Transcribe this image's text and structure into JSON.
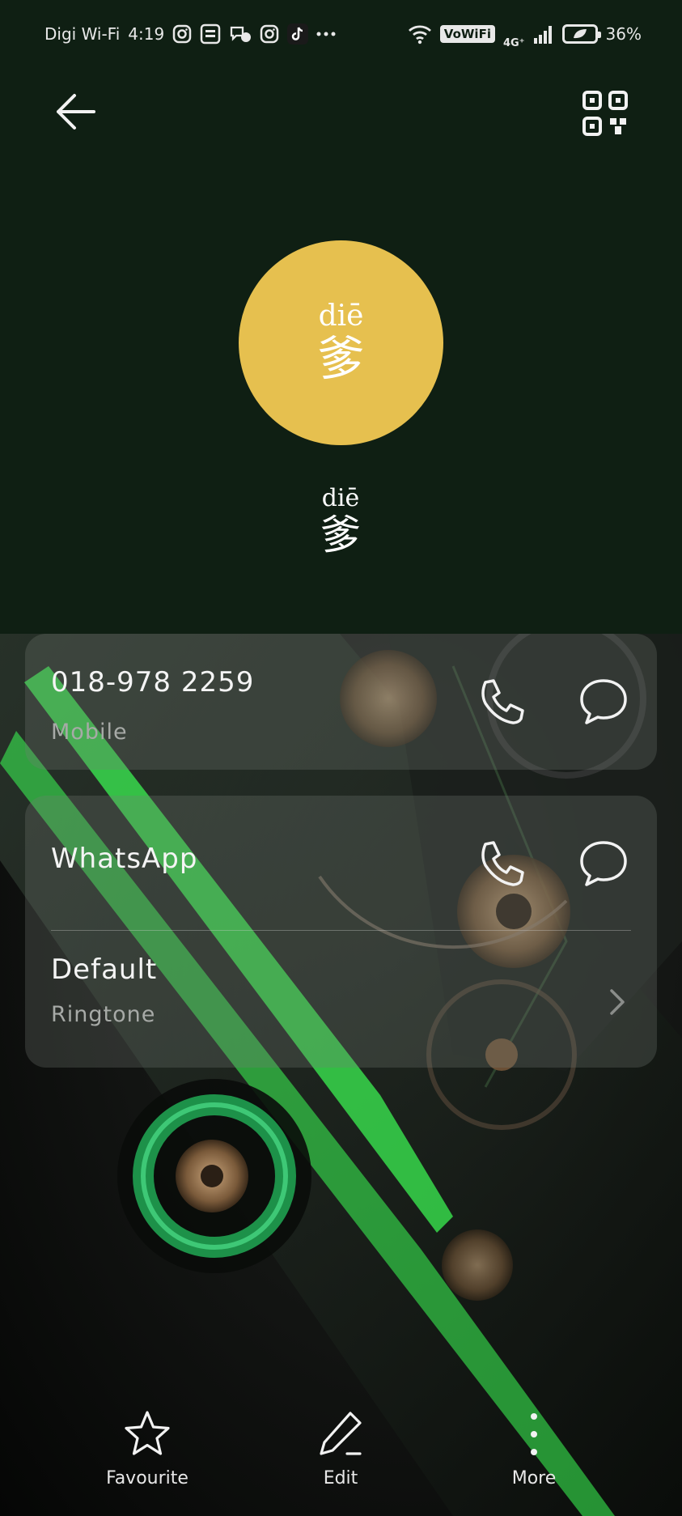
{
  "status_bar": {
    "carrier": "Digi Wi-Fi",
    "time": "4:19",
    "wifi_label": "VoWiFi",
    "network": "4G⁺",
    "battery": "36%"
  },
  "contact": {
    "avatar_pinyin": "diē",
    "avatar_char": "爹",
    "name_pinyin": "diē",
    "name_char": "爹"
  },
  "phone": {
    "number": "018-978 2259",
    "type": "Mobile"
  },
  "apps": {
    "whatsapp_label": "WhatsApp",
    "ringtone_value": "Default",
    "ringtone_label": "Ringtone"
  },
  "bottom_bar": {
    "favourite": "Favourite",
    "edit": "Edit",
    "more": "More"
  },
  "colors": {
    "header_bg": "#0f1f13",
    "avatar_bg": "#e6c04f",
    "accent_green": "#3dff55"
  }
}
